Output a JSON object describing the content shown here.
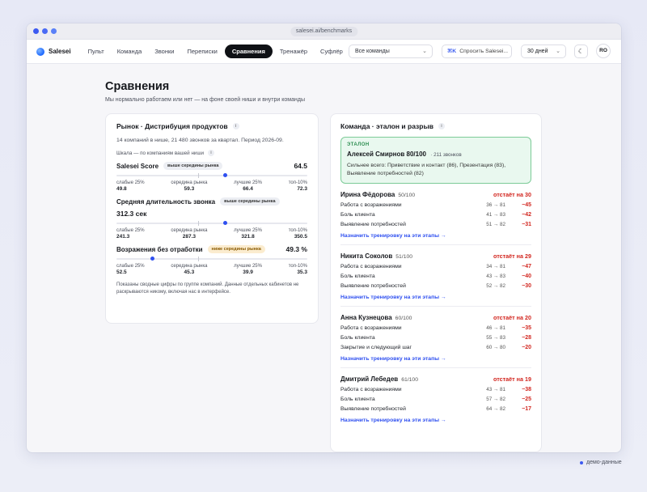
{
  "browser": {
    "url": "salesei.ai/benchmarks"
  },
  "nav": {
    "brand": "Salesei",
    "tabs": [
      "Пульт",
      "Команда",
      "Звонки",
      "Переписки",
      "Сравнения",
      "Тренажёр",
      "Суфлёр"
    ],
    "active_tab": "Сравнения",
    "team_select": "Все команды",
    "ask_kbd": "⌘K",
    "ask_label": "Спросить Salesei...",
    "period": "30 дней",
    "avatar": "RO"
  },
  "page": {
    "title": "Сравнения",
    "subtitle": "Мы нормально работаем или нет — на фоне своей ниши и внутри команды"
  },
  "market": {
    "title": "Рынок · Дистрибуция продуктов",
    "meta": "14 компаний в нише, 21 480 звонков за квартал. Период 2026-09.",
    "scale_note": "Шкала — по компаниям вашей ниши",
    "tick_labels": [
      "слабые 25%",
      "середина рынка",
      "лучшие 25%",
      "топ-10%"
    ],
    "metrics": [
      {
        "name": "Salesei Score",
        "badge": "выше середины рынка",
        "badge_type": "ok",
        "value": "64.5",
        "position": 0.57,
        "ticks": [
          "49.8",
          "59.3",
          "66.4",
          "72.3"
        ]
      },
      {
        "name": "Средняя длительность звонка",
        "badge": "выше середины рынка",
        "badge_type": "ok",
        "value": "312.3 сек",
        "position": 0.57,
        "ticks": [
          "241.3",
          "287.3",
          "321.8",
          "350.5"
        ]
      },
      {
        "name": "Возражения без отработки",
        "badge": "ниже середины рынка",
        "badge_type": "warn",
        "value": "49.3 %",
        "position": 0.19,
        "ticks": [
          "52.5",
          "45.3",
          "39.9",
          "35.3"
        ]
      }
    ],
    "footnote": "Показаны сводные цифры по группе компаний. Данные отдельных кабинетов не раскрываются никому, включая нас в интерфейсе."
  },
  "team": {
    "title": "Команда · эталон и разрыв",
    "etalon": {
      "label": "ЭТАЛОН",
      "name": "Алексей Смирнов",
      "score": "80/100",
      "calls": "· 211 звонков",
      "strong": "Сильнее всего: Приветствие и контакт (86), Презентация (83), Выявление потребностей (82)"
    },
    "link_label": "Назначить тренировку на эти этапы →",
    "members": [
      {
        "name": "Ирина Фёдорова",
        "score": "50/100",
        "gap": "отстаёт на 30",
        "stages": [
          {
            "name": "Работа с возражениями",
            "values": "36 → 81",
            "delta": "−45"
          },
          {
            "name": "Боль клиента",
            "values": "41 → 83",
            "delta": "−42"
          },
          {
            "name": "Выявление потребностей",
            "values": "51 → 82",
            "delta": "−31"
          }
        ]
      },
      {
        "name": "Никита Соколов",
        "score": "51/100",
        "gap": "отстаёт на 29",
        "stages": [
          {
            "name": "Работа с возражениями",
            "values": "34 → 81",
            "delta": "−47"
          },
          {
            "name": "Боль клиента",
            "values": "43 → 83",
            "delta": "−40"
          },
          {
            "name": "Выявление потребностей",
            "values": "52 → 82",
            "delta": "−30"
          }
        ]
      },
      {
        "name": "Анна Кузнецова",
        "score": "60/100",
        "gap": "отстаёт на 20",
        "stages": [
          {
            "name": "Работа с возражениями",
            "values": "46 → 81",
            "delta": "−35"
          },
          {
            "name": "Боль клиента",
            "values": "55 → 83",
            "delta": "−28"
          },
          {
            "name": "Закрытие и следующий шаг",
            "values": "60 → 80",
            "delta": "−20"
          }
        ]
      },
      {
        "name": "Дмитрий Лебедев",
        "score": "61/100",
        "gap": "отстаёт на 19",
        "stages": [
          {
            "name": "Работа с возражениями",
            "values": "43 → 81",
            "delta": "−38"
          },
          {
            "name": "Боль клиента",
            "values": "57 → 82",
            "delta": "−25"
          },
          {
            "name": "Выявление потребностей",
            "values": "64 → 82",
            "delta": "−17"
          }
        ]
      }
    ]
  },
  "footer": {
    "demo": "демо-данные"
  },
  "colors": {
    "accent": "#2f50f0",
    "danger": "#d2261f",
    "etalon_bg": "#e9f8ef",
    "etalon_border": "#7ccb97"
  }
}
